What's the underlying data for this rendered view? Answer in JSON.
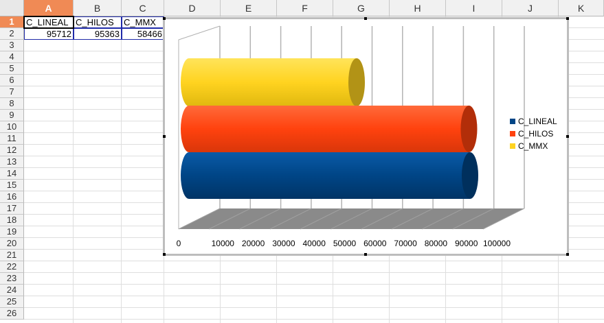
{
  "columns": [
    "A",
    "B",
    "C",
    "D",
    "E",
    "F",
    "G",
    "H",
    "I",
    "J",
    "K"
  ],
  "rows": [
    "1",
    "2",
    "3",
    "4",
    "5",
    "6",
    "7",
    "8",
    "9",
    "10",
    "11",
    "12",
    "13",
    "14",
    "15",
    "16",
    "17",
    "18",
    "19",
    "20",
    "21",
    "22",
    "23",
    "24",
    "25",
    "26"
  ],
  "cells": {
    "A1": "C_LINEAL",
    "B1": "C_HILOS",
    "C1": "C_MMX",
    "A2": "95712",
    "B2": "95363",
    "C2": "58466"
  },
  "chart_data": {
    "type": "bar",
    "orientation": "horizontal",
    "style": "3d-cylinder",
    "series": [
      {
        "name": "C_LINEAL",
        "values": [
          95712
        ],
        "color": "#004586"
      },
      {
        "name": "C_HILOS",
        "values": [
          95363
        ],
        "color": "#ff420e"
      },
      {
        "name": "C_MMX",
        "values": [
          58466
        ],
        "color": "#ffd320"
      }
    ],
    "x_ticks": [
      "0",
      "10000",
      "20000",
      "30000",
      "40000",
      "50000",
      "60000",
      "70000",
      "80000",
      "90000",
      "100000"
    ],
    "xlim": [
      0,
      100000
    ],
    "grid": true,
    "legend": "right"
  }
}
